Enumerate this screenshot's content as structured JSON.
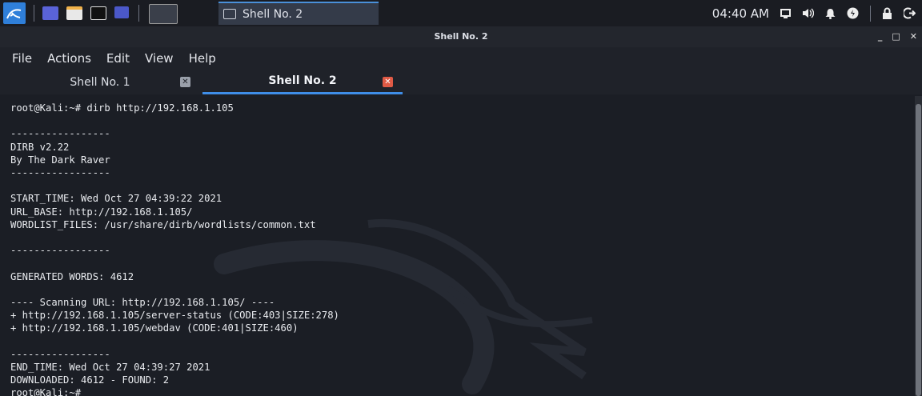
{
  "taskbar": {
    "active_task_label": "Shell No. 2",
    "clock": "04:40 AM"
  },
  "window": {
    "title": "Shell No. 2",
    "minimize": "_",
    "maximize": "□",
    "close": "✕"
  },
  "menu": {
    "items": [
      "File",
      "Actions",
      "Edit",
      "View",
      "Help"
    ]
  },
  "tabs": [
    {
      "label": "Shell No. 1",
      "active": false
    },
    {
      "label": "Shell No. 2",
      "active": true
    }
  ],
  "terminal": {
    "lines": [
      "root@Kali:~# dirb http://192.168.1.105",
      "",
      "-----------------",
      "DIRB v2.22",
      "By The Dark Raver",
      "-----------------",
      "",
      "START_TIME: Wed Oct 27 04:39:22 2021",
      "URL_BASE: http://192.168.1.105/",
      "WORDLIST_FILES: /usr/share/dirb/wordlists/common.txt",
      "",
      "-----------------",
      "",
      "GENERATED WORDS: 4612",
      "",
      "---- Scanning URL: http://192.168.1.105/ ----",
      "+ http://192.168.1.105/server-status (CODE:403|SIZE:278)",
      "+ http://192.168.1.105/webdav (CODE:401|SIZE:460)",
      "",
      "-----------------",
      "END_TIME: Wed Oct 27 04:39:27 2021",
      "DOWNLOADED: 4612 - FOUND: 2",
      "root@Kali:~#"
    ]
  },
  "colors": {
    "accent": "#3f8ee8",
    "terminal_bg": "#1b1e25",
    "close_active": "#e05a45"
  }
}
